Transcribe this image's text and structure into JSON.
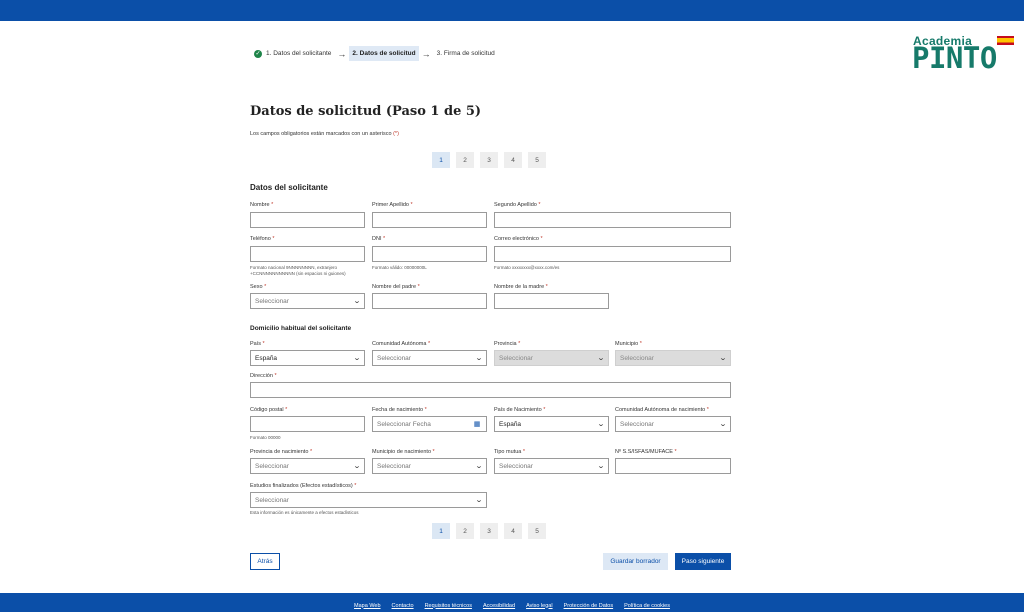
{
  "stepper": {
    "steps": [
      {
        "label": "1. Datos del solicitante",
        "state": "done"
      },
      {
        "label": "2. Datos de solicitud",
        "state": "active"
      },
      {
        "label": "3. Firma de solicitud",
        "state": "pending"
      }
    ]
  },
  "logo": {
    "line1": "Academia",
    "line2": "PINTO"
  },
  "page": {
    "title": "Datos de solicitud (Paso 1 de 5)",
    "required_note": "Los campos obligatorios están marcados con un asterisco",
    "required_mark": "(*)"
  },
  "pager": {
    "pages": [
      "1",
      "2",
      "3",
      "4",
      "5"
    ],
    "current": "1"
  },
  "applicant": {
    "title": "Datos del solicitante",
    "nombre": {
      "label": "Nombre",
      "value": ""
    },
    "primer_apellido": {
      "label": "Primer Apellido",
      "value": ""
    },
    "segundo_apellido": {
      "label": "Segundo Apellido",
      "value": ""
    },
    "telefono": {
      "label": "Teléfono",
      "value": "",
      "help1": "Formato nacional 9NNNNNNNN, extranjero",
      "help2": "+CCNNNNNNNNNNN (sin espacios ni guiones)"
    },
    "dni": {
      "label": "DNI",
      "value": "",
      "help": "Formato válido: 00000000L"
    },
    "correo": {
      "label": "Correo electrónico",
      "value": "",
      "help": "Formato xxxxxxxx@xxxx.com/es"
    },
    "sexo": {
      "label": "Sexo",
      "placeholder": "Seleccionar"
    },
    "nombre_padre": {
      "label": "Nombre del padre",
      "value": ""
    },
    "nombre_madre": {
      "label": "Nombre de la madre",
      "value": ""
    }
  },
  "domicilio": {
    "title": "Domicilio habitual del solicitante",
    "pais": {
      "label": "País",
      "value": "España"
    },
    "comunidad": {
      "label": "Comunidad Autónoma",
      "placeholder": "Seleccionar"
    },
    "provincia": {
      "label": "Provincia",
      "placeholder": "Seleccionar"
    },
    "municipio": {
      "label": "Municipio",
      "placeholder": "Seleccionar"
    },
    "direccion": {
      "label": "Dirección",
      "value": ""
    },
    "codigo_postal": {
      "label": "Código postal",
      "value": "",
      "help": "Formato 00000"
    },
    "fecha_nacimiento": {
      "label": "Fecha de nacimiento",
      "placeholder": "Seleccionar Fecha"
    },
    "pais_nacimiento": {
      "label": "País de Nacimiento",
      "value": "España"
    },
    "comunidad_nacimiento": {
      "label": "Comunidad Autónoma de nacimiento",
      "placeholder": "Seleccionar"
    },
    "provincia_nacimiento": {
      "label": "Provincia de nacimiento",
      "placeholder": "Seleccionar"
    },
    "municipio_nacimiento": {
      "label": "Municipio de nacimiento",
      "placeholder": "Seleccionar"
    },
    "tipo_mutua": {
      "label": "Tipo mutua",
      "placeholder": "Seleccionar"
    },
    "ss": {
      "label": "Nº S.S/ISFAS/MUFACE",
      "value": ""
    },
    "estudios": {
      "label": "Estudios finalizados (Efectos estadísticos)",
      "placeholder": "Seleccionar",
      "help": "Esta información es únicamente a efectos estadísticos"
    }
  },
  "buttons": {
    "back": "Atrás",
    "draft": "Guardar borrador",
    "next": "Paso siguiente"
  },
  "footer": {
    "links": [
      "Mapa Web",
      "Contacto",
      "Requisitos técnicos",
      "Accesibilidad",
      "Aviso legal",
      "Protección de Datos",
      "Política de cookies"
    ]
  },
  "colors": {
    "primary": "#0b4fa8",
    "logo": "#167a6a",
    "required": "#c0392b",
    "success": "#1e8449"
  }
}
